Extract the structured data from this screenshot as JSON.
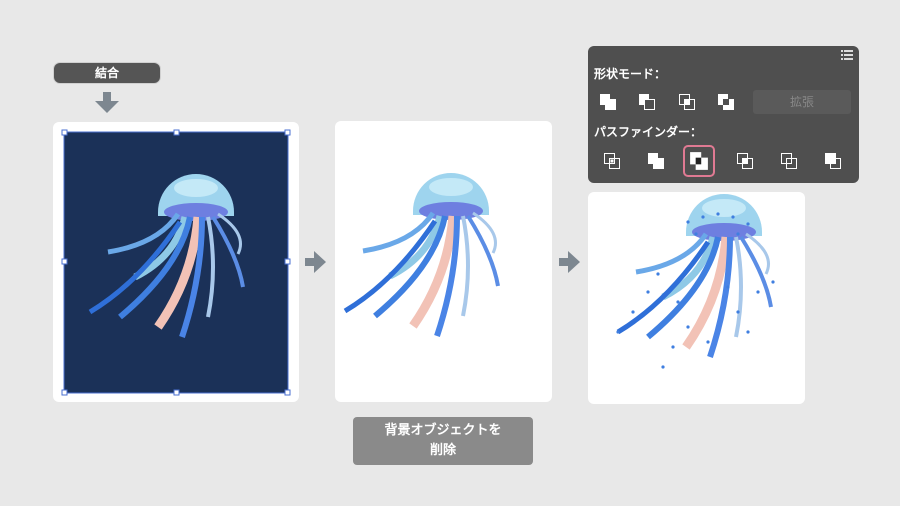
{
  "labels": {
    "unite": "結合",
    "remove_bg_line1": "背景オブジェクトを",
    "remove_bg_line2": "削除"
  },
  "pathfinder_panel": {
    "shape_modes_label": "形状モード：",
    "pathfinders_label": "パスファインダー：",
    "expand_label": "拡張",
    "shape_mode_buttons": [
      "unite-icon",
      "minus-front-icon",
      "intersect-icon",
      "exclude-icon"
    ],
    "pathfinder_buttons": [
      "divide-icon",
      "trim-icon",
      "merge-icon",
      "crop-icon",
      "outline-icon",
      "minus-back-icon"
    ],
    "active_button": "merge-icon"
  },
  "colors": {
    "background": "#e8e8e8",
    "navy": "#1b3158",
    "panel": "#4f4f4f",
    "highlight": "#e07a93",
    "arrow": "#7d8790",
    "pill": "#555555"
  }
}
